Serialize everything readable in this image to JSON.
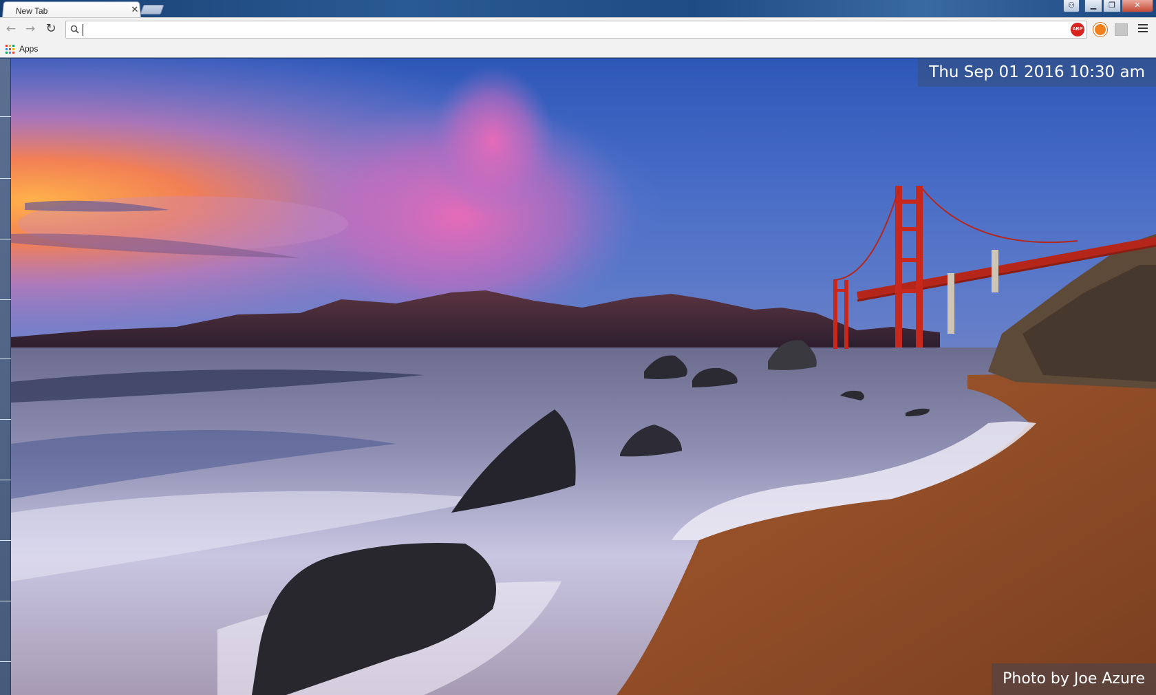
{
  "browser": {
    "tab": {
      "title": "New Tab",
      "close_icon": "close-icon"
    },
    "window_controls": {
      "user": "user-icon",
      "minimize": "minimize-icon",
      "restore": "restore-icon",
      "close": "close-icon"
    },
    "toolbar": {
      "back_icon": "back-arrow-icon",
      "forward_icon": "forward-arrow-icon",
      "reload_icon": "reload-icon",
      "omnibox_value": "",
      "omnibox_placeholder": "",
      "star_icon": "star-icon",
      "extensions": [
        {
          "name": "adblock-plus-icon",
          "label": "ABP",
          "color": "#d8221e"
        },
        {
          "name": "orange-extension-icon",
          "color": "#f2801e"
        },
        {
          "name": "gray-extension-icon",
          "color": "#c7c7c7"
        }
      ],
      "menu_icon": "menu-icon"
    },
    "bookmarks_bar": {
      "apps_label": "Apps"
    }
  },
  "newtab": {
    "datetime": "Thu Sep 01 2016 10:30 am",
    "photo_credit": "Photo by Joe Azure"
  },
  "colors": {
    "titlebar": "#1f4b83",
    "overlay": "#375078",
    "bridge": "#c8281c"
  }
}
